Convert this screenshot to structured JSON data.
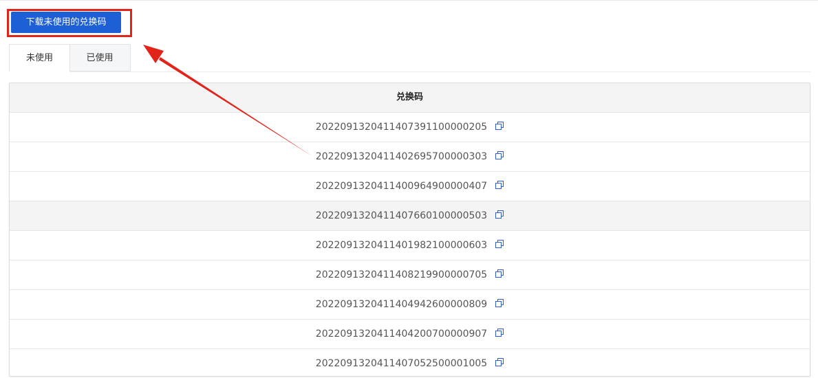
{
  "toolbar": {
    "download_label": "下载未使用的兑换码"
  },
  "tabs": [
    {
      "label": "未使用",
      "active": true
    },
    {
      "label": "已使用",
      "active": false
    }
  ],
  "table": {
    "header": "兑换码",
    "rows": [
      "2022091320411407391100000205",
      "2022091320411402695700000303",
      "2022091320411400964900000407",
      "2022091320411407660100000503",
      "2022091320411401982100000603",
      "2022091320411408219900000705",
      "2022091320411404942600000809",
      "2022091320411404200700000907",
      "2022091320411407052500001005"
    ],
    "hovered_row_index": 3
  },
  "icons": {
    "copy": "copy-icon",
    "annotation_arrow": "arrow-icon"
  },
  "colors": {
    "primary_button": "#1e5fd6",
    "annotation_red": "#e2231a",
    "icon_blue": "#2d5bd1"
  }
}
